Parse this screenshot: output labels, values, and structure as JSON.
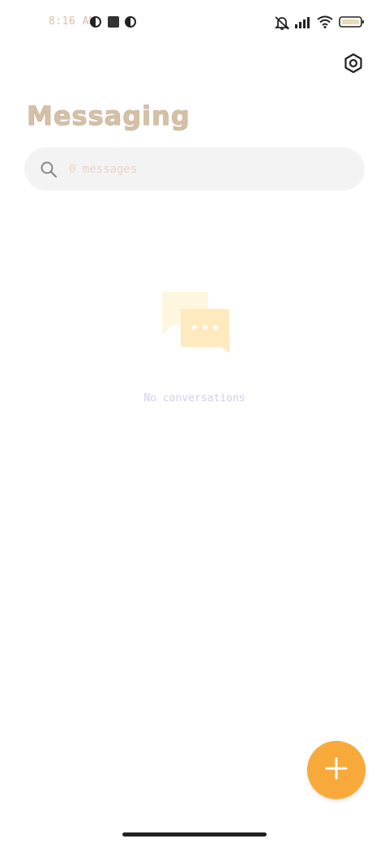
{
  "status_bar": {
    "time": "8:16 AM",
    "left_icons": [
      "app-circle-icon",
      "app-square-icon",
      "app-circle-icon"
    ],
    "right_icons": [
      "silent-bell-icon",
      "signal-icon",
      "wifi-icon",
      "battery-icon"
    ]
  },
  "header": {
    "title": "Messaging",
    "settings_icon": "gear-icon"
  },
  "search": {
    "placeholder": "0 messages",
    "icon": "search-icon"
  },
  "empty_state": {
    "icon": "chat-bubbles-icon",
    "text": "No conversations"
  },
  "fab": {
    "icon": "plus-icon",
    "color": "#f7aa3a"
  },
  "colors": {
    "accent": "#f7aa3a",
    "search_bg": "#f3f3f3"
  }
}
